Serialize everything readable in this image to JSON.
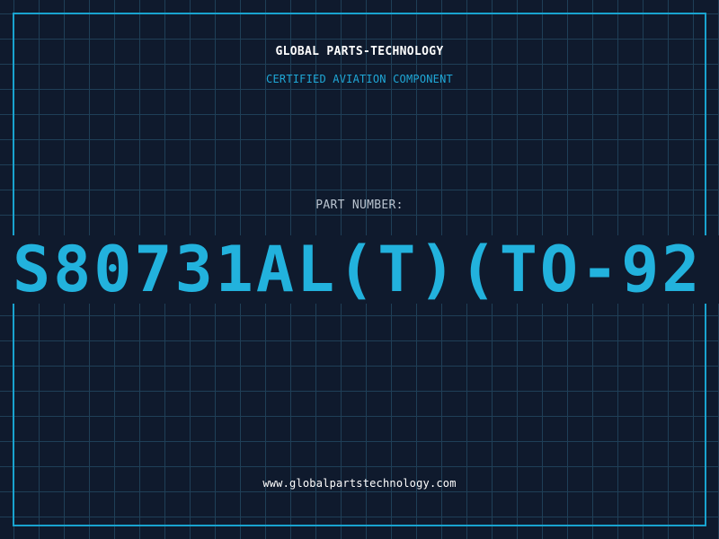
{
  "header": {
    "company": "GLOBAL PARTS-TECHNOLOGY",
    "subtitle": "CERTIFIED AVIATION COMPONENT"
  },
  "part": {
    "label": "PART NUMBER:",
    "number": "S80731AL(T)(TO-92"
  },
  "footer": {
    "website": "www.globalpartstechnology.com"
  },
  "colors": {
    "background": "#0f1a2d",
    "grid": "#1f3f57",
    "accent": "#19a3cf",
    "part_number": "#22b2dd",
    "text": "#ffffff",
    "label": "#b9c3cf"
  }
}
